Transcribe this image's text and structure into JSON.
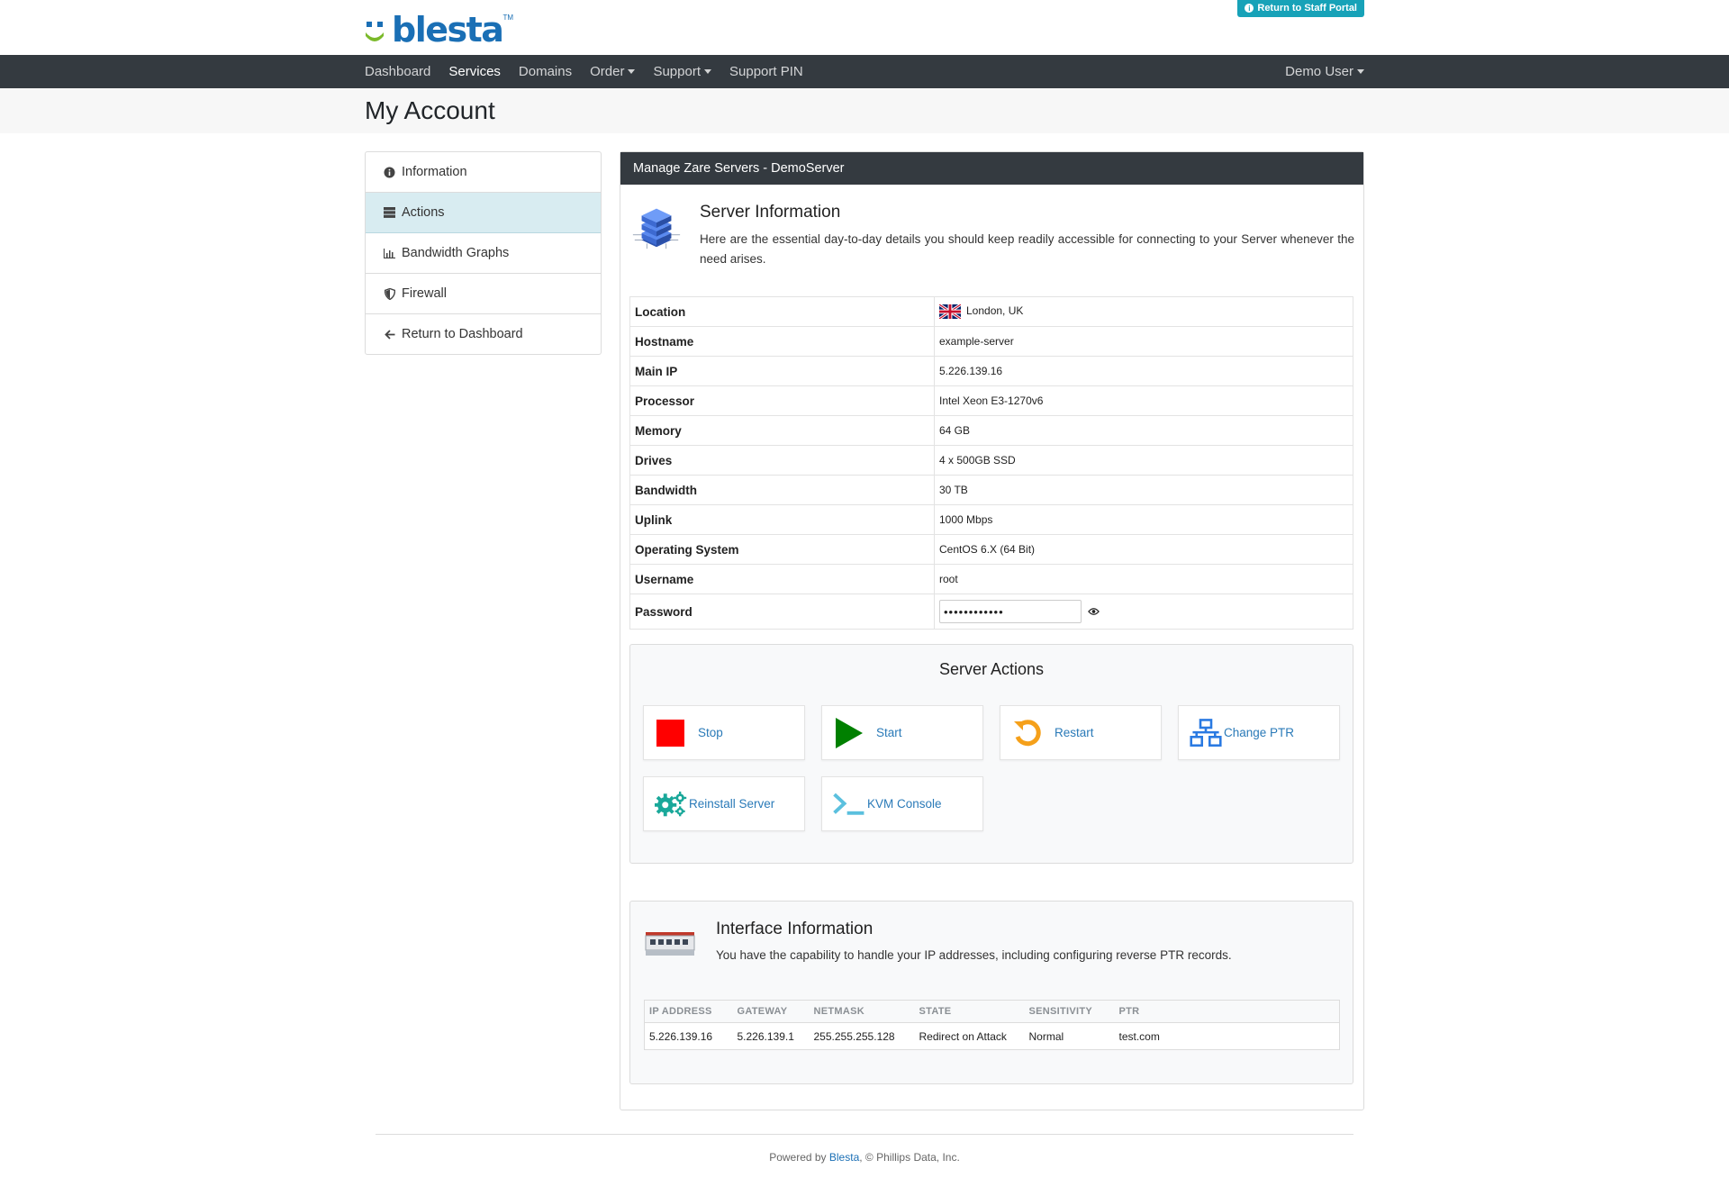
{
  "header": {
    "logo_text": "blesta",
    "logo_tm": "TM",
    "staff_button": "Return to Staff Portal"
  },
  "nav": {
    "items": [
      {
        "label": "Dashboard"
      },
      {
        "label": "Services"
      },
      {
        "label": "Domains"
      },
      {
        "label": "Order"
      },
      {
        "label": "Support"
      },
      {
        "label": "Support PIN"
      }
    ],
    "user": "Demo User"
  },
  "page_title": "My Account",
  "sidebar": {
    "items": [
      {
        "label": "Information",
        "icon": "info-circle-icon"
      },
      {
        "label": "Actions",
        "icon": "server-stack-icon"
      },
      {
        "label": "Bandwidth Graphs",
        "icon": "bar-chart-icon"
      },
      {
        "label": "Firewall",
        "icon": "shield-icon"
      },
      {
        "label": "Return to Dashboard",
        "icon": "arrow-left-icon"
      }
    ]
  },
  "panel": {
    "title": "Manage Zare Servers - DemoServer",
    "server_info_title": "Server Information",
    "server_info_desc": "Here are the essential day-to-day details you should keep readily accessible for connecting to your Server whenever the need arises.",
    "details": [
      {
        "key": "Location",
        "value": "London, UK"
      },
      {
        "key": "Hostname",
        "value": "example-server"
      },
      {
        "key": "Main IP",
        "value": "5.226.139.16"
      },
      {
        "key": "Processor",
        "value": "Intel Xeon E3-1270v6"
      },
      {
        "key": "Memory",
        "value": "64 GB"
      },
      {
        "key": "Drives",
        "value": "4 x 500GB SSD"
      },
      {
        "key": "Bandwidth",
        "value": "30 TB"
      },
      {
        "key": "Uplink",
        "value": "1000 Mbps"
      },
      {
        "key": "Operating System",
        "value": "CentOS 6.X (64 Bit)"
      },
      {
        "key": "Username",
        "value": "root"
      },
      {
        "key": "Password",
        "value": "••••••••••••"
      }
    ]
  },
  "actions": {
    "title": "Server Actions",
    "items": [
      {
        "label": "Stop",
        "icon": "stop-icon",
        "color": "#ff0000"
      },
      {
        "label": "Start",
        "icon": "play-icon",
        "color": "#008000"
      },
      {
        "label": "Restart",
        "icon": "restart-icon",
        "color": "#f5a01a"
      },
      {
        "label": "Change PTR",
        "icon": "network-icon",
        "color": "#2a7ae2"
      },
      {
        "label": "Reinstall Server",
        "icon": "gears-icon",
        "color": "#1aa89a"
      },
      {
        "label": "KVM Console",
        "icon": "terminal-icon",
        "color": "#5bc0de"
      }
    ]
  },
  "interface": {
    "title": "Interface Information",
    "desc": "You have the capability to handle your IP addresses, including configuring reverse PTR records.",
    "columns": [
      "IP ADDRESS",
      "GATEWAY",
      "NETMASK",
      "STATE",
      "SENSITIVITY",
      "PTR"
    ],
    "rows": [
      [
        "5.226.139.16",
        "5.226.139.1",
        "255.255.255.128",
        "Redirect on Attack",
        "Normal",
        "test.com"
      ]
    ]
  },
  "footer": {
    "prefix": "Powered by ",
    "link": "Blesta",
    "suffix": ", © Phillips Data, Inc."
  }
}
